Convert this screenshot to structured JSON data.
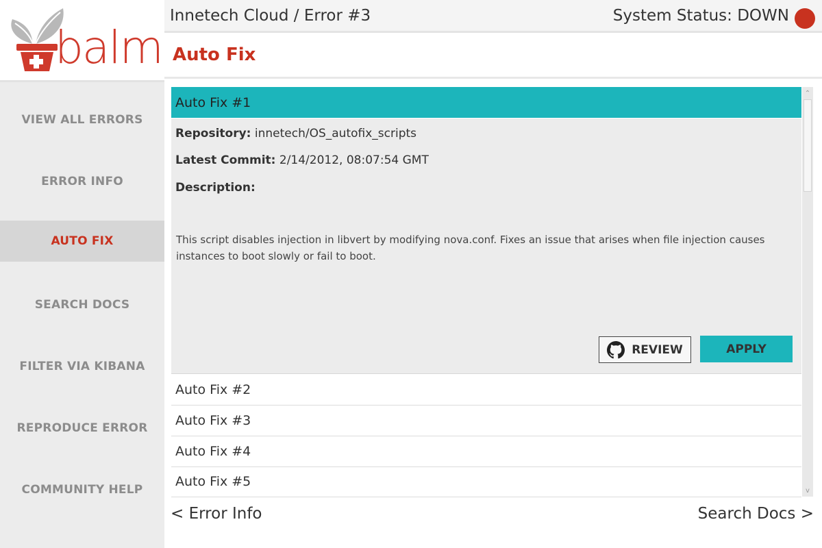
{
  "app": {
    "logo_text": "balm"
  },
  "header": {
    "breadcrumb": "Innetech Cloud / Error #3",
    "status_label": "System Status: DOWN",
    "status_color": "#c8321f"
  },
  "page": {
    "title": "Auto Fix"
  },
  "sidebar": {
    "items": [
      {
        "label": "VIEW ALL ERRORS"
      },
      {
        "label": "ERROR INFO"
      },
      {
        "label": "AUTO FIX",
        "active": true
      },
      {
        "label": "SEARCH DOCS"
      },
      {
        "label": "FILTER VIA KIBANA"
      },
      {
        "label": "REPRODUCE ERROR"
      },
      {
        "label": "COMMUNITY HELP"
      }
    ]
  },
  "fixes": [
    {
      "title": "Auto Fix #1",
      "expanded": true
    },
    {
      "title": "Auto Fix #2"
    },
    {
      "title": "Auto Fix #3"
    },
    {
      "title": "Auto Fix #4"
    },
    {
      "title": "Auto Fix #5"
    }
  ],
  "detail": {
    "repository_label": "Repository:",
    "repository_value": "innetech/OS_autofix_scripts",
    "commit_label": "Latest Commit:",
    "commit_value": "2/14/2012, 08:07:54 GMT",
    "description_label": "Description:",
    "description_text": "This script disables injection in libvert by modifying nova.conf. Fixes an issue that arises when file injection causes instances to boot slowly or fail to boot.",
    "review_label": "REVIEW",
    "apply_label": "APPLY",
    "review_icon": "github-icon"
  },
  "footer": {
    "prev_label": "< Error Info",
    "next_label": "Search Docs >"
  },
  "colors": {
    "accent": "#1cb5bb",
    "brand": "#c8321f"
  }
}
